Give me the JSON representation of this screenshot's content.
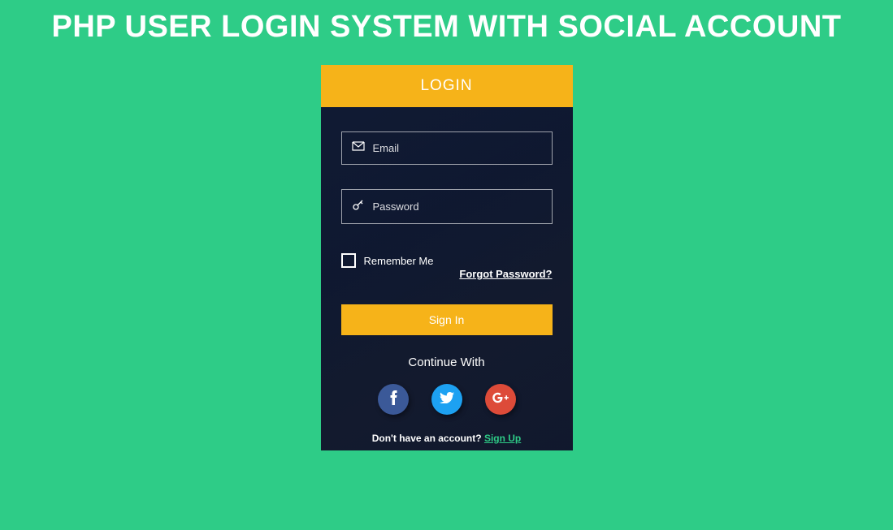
{
  "page": {
    "title": "PHP USER LOGIN SYSTEM WITH SOCIAL ACCOUNT"
  },
  "login": {
    "header": "LOGIN",
    "email_placeholder": "Email",
    "password_placeholder": "Password",
    "forgot_link": "Forgot Password?",
    "remember_label": "Remember Me",
    "signin_button": "Sign In",
    "continue_text": "Continue With",
    "signup_prompt": "Don't have an account? ",
    "signup_link": "Sign Up"
  },
  "social": {
    "facebook": "facebook",
    "twitter": "twitter",
    "google": "google-plus"
  }
}
